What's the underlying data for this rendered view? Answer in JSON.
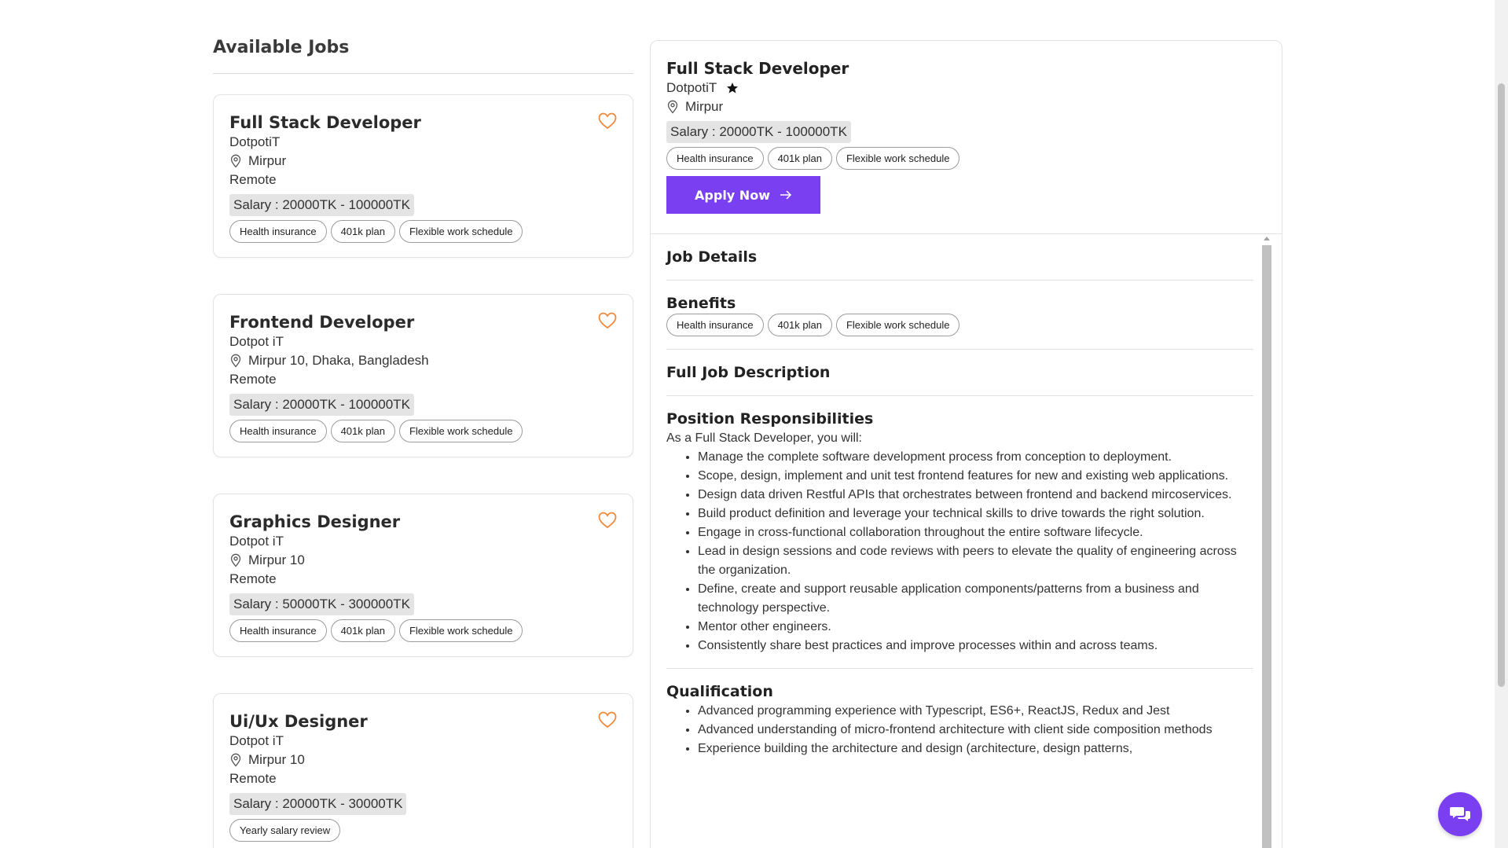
{
  "list": {
    "heading": "Available Jobs",
    "jobs": [
      {
        "title": "Full Stack Developer",
        "company": "DotpotiT",
        "location": "Mirpur",
        "type": "Remote",
        "salary": "Salary : 20000TK - 100000TK",
        "tags": [
          "Health insurance",
          "401k plan",
          "Flexible work schedule"
        ]
      },
      {
        "title": "Frontend Developer",
        "company": "Dotpot iT",
        "location": "Mirpur 10, Dhaka, Bangladesh",
        "type": "Remote",
        "salary": "Salary : 20000TK - 100000TK",
        "tags": [
          "Health insurance",
          "401k plan",
          "Flexible work schedule"
        ]
      },
      {
        "title": "Graphics Designer",
        "company": "Dotpot iT",
        "location": "Mirpur 10",
        "type": "Remote",
        "salary": "Salary : 50000TK - 300000TK",
        "tags": [
          "Health insurance",
          "401k plan",
          "Flexible work schedule"
        ]
      },
      {
        "title": "Ui/Ux Designer",
        "company": "Dotpot iT",
        "location": "Mirpur 10",
        "type": "Remote",
        "salary": "Salary : 20000TK - 30000TK",
        "tags": [
          "Yearly salary review"
        ]
      }
    ]
  },
  "detail": {
    "title": "Full Stack Developer",
    "company": "DotpotiT",
    "location": "Mirpur",
    "salary": "Salary : 20000TK - 100000TK",
    "tags": [
      "Health insurance",
      "401k plan",
      "Flexible work schedule"
    ],
    "apply_label": "Apply Now",
    "job_details_heading": "Job Details",
    "benefits_heading": "Benefits",
    "benefits": [
      "Health insurance",
      "401k plan",
      "Flexible work schedule"
    ],
    "full_desc_heading": "Full Job Description",
    "responsibilities_heading": "Position Responsibilities",
    "responsibilities_intro": "As a Full Stack Developer, you will:",
    "responsibilities": [
      "Manage the complete software development process from conception to deployment.",
      "Scope, design, implement and unit test frontend features for new and existing web applications.",
      "Design data driven Restful APIs that orchestrates between frontend and backend mircoservices.",
      "Build product definition and leverage your technical skills to drive towards the right solution.",
      "Engage in cross-functional collaboration throughout the entire software lifecycle.",
      "Lead in design sessions and code reviews with peers to elevate the quality of engineering across the organization.",
      "Define, create and support reusable application components/patterns from a business and technology perspective.",
      "Mentor other engineers.",
      "Consistently share best practices and improve processes within and across teams."
    ],
    "qualification_heading": "Qualification",
    "qualifications": [
      "Advanced programming experience with Typescript, ES6+, ReactJS, Redux and Jest",
      "Advanced understanding of micro-frontend architecture with client side composition methods",
      "Experience building the architecture and design (architecture, design patterns,"
    ]
  },
  "icons": {
    "favorite": "heart-icon",
    "location": "map-pin-icon",
    "rating": "star-icon",
    "apply_arrow": "arrow-right-icon",
    "chat": "chat-icon"
  },
  "colors": {
    "accent": "#7b3ff2",
    "heart": "#f08a3c",
    "salary_bg": "#e4e4e4"
  }
}
